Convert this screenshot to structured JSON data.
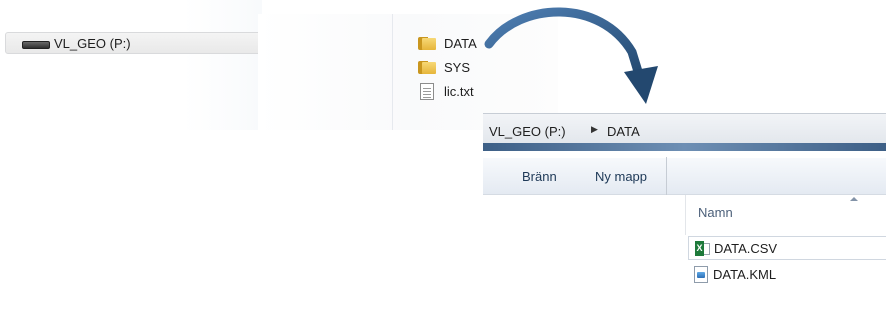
{
  "nav": {
    "drive_label": "VL_GEO (P:)",
    "drive_icon": "drive-icon"
  },
  "root_files": [
    {
      "name": "DATA",
      "icon": "folder-icon"
    },
    {
      "name": "SYS",
      "icon": "folder-icon"
    },
    {
      "name": "lic.txt",
      "icon": "text-file-icon"
    }
  ],
  "window": {
    "breadcrumb": [
      "VL_GEO (P:)",
      "DATA"
    ],
    "commands": [
      "Bränn",
      "Ny mapp"
    ],
    "column_header": "Namn",
    "files": [
      {
        "name": "DATA.CSV",
        "icon": "excel-csv-icon",
        "selected": true
      },
      {
        "name": "DATA.KML",
        "icon": "kml-file-icon",
        "selected": false
      }
    ]
  },
  "colors": {
    "arrow": "#2f5c8f",
    "folder": "#e6b53b",
    "excel": "#1e7a3a"
  }
}
